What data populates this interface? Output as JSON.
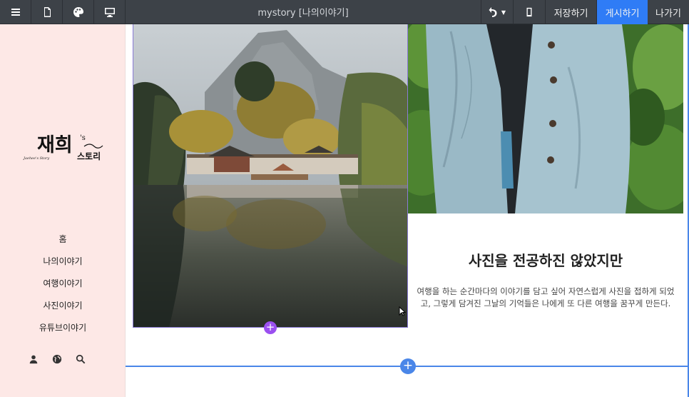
{
  "toolbar": {
    "title": "mystory [나의이야기]",
    "save_label": "저장하기",
    "publish_label": "게시하기",
    "exit_label": "나가기",
    "icons": [
      "menu-icon",
      "page-icon",
      "palette-icon",
      "desktop-icon",
      "undo-icon",
      "mobile-icon"
    ],
    "publish_color": "#2f7cf6"
  },
  "sidebar": {
    "logo_main": "재희",
    "logo_small": "'s",
    "logo_sub": "스토리",
    "logo_script": "Jaehee's Story",
    "nav": [
      "홈",
      "나의이야기",
      "여행이야기",
      "사진이야기",
      "유튜브이야기"
    ],
    "icons": [
      "user-icon",
      "globe-icon",
      "search-icon"
    ],
    "background": "#fde8e6"
  },
  "content": {
    "heading": "사진을 전공하진 않았지만",
    "description": "여행을 하는 순간마다의 이야기를 담고 싶어 자연스럽게 사진을 접하게 되었고, 그렇게 담겨진 그날의 기억들은 나에게 또 다른 여행을 꿈꾸게 만든다.",
    "add_symbol": "+",
    "accent": "#4a86e8",
    "add_small_color": "#9b4ff0"
  }
}
